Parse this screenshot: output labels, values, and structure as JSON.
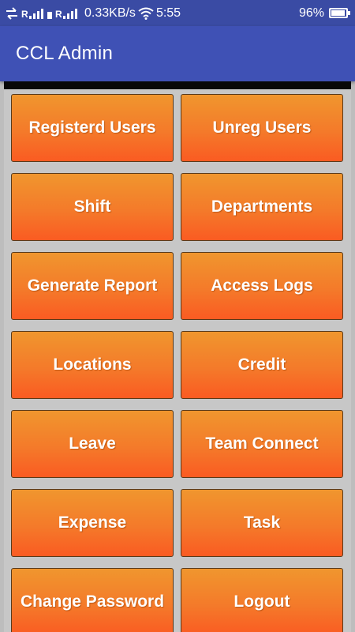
{
  "status_bar": {
    "carrier1": "R",
    "carrier2": "R",
    "speed": "0.33KB/s",
    "time": "5:55",
    "battery": "96%"
  },
  "app_bar": {
    "title": "CCL Admin"
  },
  "menu": [
    {
      "label": "Registerd Users"
    },
    {
      "label": "Unreg Users"
    },
    {
      "label": "Shift"
    },
    {
      "label": "Departments"
    },
    {
      "label": "Generate Report"
    },
    {
      "label": "Access Logs"
    },
    {
      "label": "Locations"
    },
    {
      "label": "Credit"
    },
    {
      "label": "Leave"
    },
    {
      "label": "Team Connect"
    },
    {
      "label": "Expense"
    },
    {
      "label": "Task"
    },
    {
      "label": "Change Password"
    },
    {
      "label": "Logout"
    }
  ],
  "colors": {
    "app_bar": "#3f51b5",
    "status_bar": "#3a4ba4",
    "tile_top": "#f0962e",
    "tile_bottom": "#fa5b22"
  }
}
